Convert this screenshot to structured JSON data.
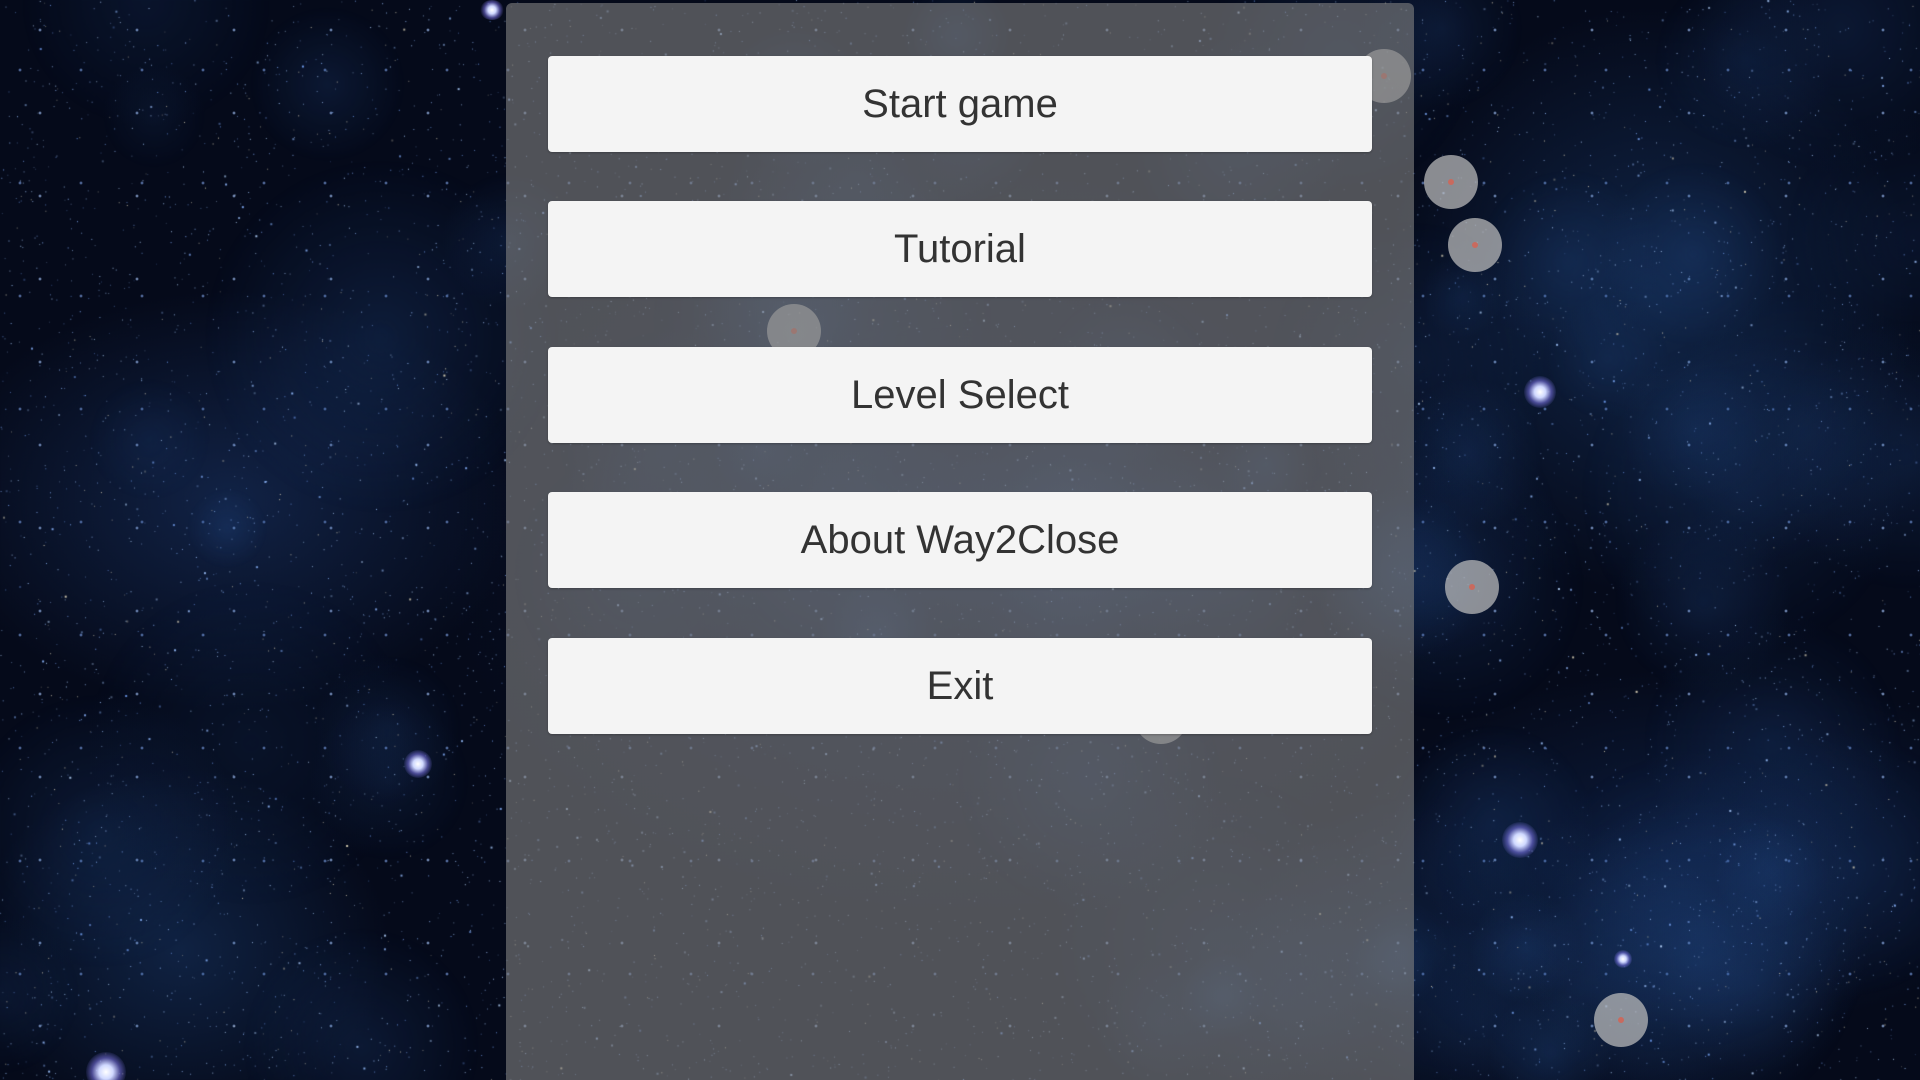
{
  "menu": {
    "buttons": [
      {
        "label": "Start game"
      },
      {
        "label": "Tutorial"
      },
      {
        "label": "Level Select"
      },
      {
        "label": "About Way2Close"
      },
      {
        "label": "Exit"
      }
    ]
  },
  "colors": {
    "space_background": "#050a1a",
    "panel": "#808080",
    "button": "#f4f4f4",
    "button_text": "#333333",
    "orb": "#bebebe",
    "orb_core": "#c96a5e"
  }
}
